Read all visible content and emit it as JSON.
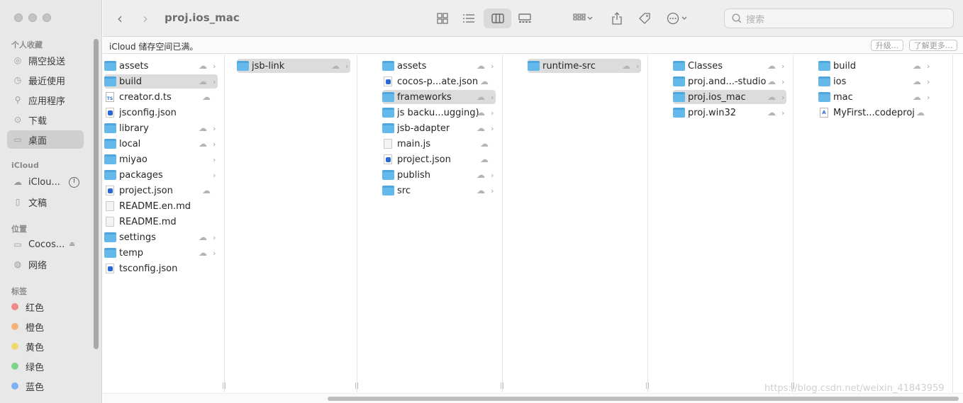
{
  "window": {
    "title": "proj.ios_mac"
  },
  "search": {
    "placeholder": "搜索"
  },
  "icloud_bar": {
    "message": "iCloud 储存空间已满。",
    "upgrade_label": "升级...",
    "learn_more_label": "了解更多..."
  },
  "sidebar": {
    "favorites_title": "个人收藏",
    "favorites": [
      {
        "label": "隔空投送",
        "icon": "airdrop-icon"
      },
      {
        "label": "最近使用",
        "icon": "clock-icon"
      },
      {
        "label": "应用程序",
        "icon": "apps-icon"
      },
      {
        "label": "下载",
        "icon": "download-icon"
      },
      {
        "label": "桌面",
        "icon": "desktop-icon",
        "selected": true
      }
    ],
    "icloud_title": "iCloud",
    "icloud": [
      {
        "label": "iClou...",
        "icon": "cloud-icon"
      },
      {
        "label": "文稿",
        "icon": "document-icon"
      }
    ],
    "locations_title": "位置",
    "locations": [
      {
        "label": "Cocos...",
        "icon": "drive-icon"
      },
      {
        "label": "网络",
        "icon": "network-icon"
      }
    ],
    "tags_title": "标签",
    "tags": [
      {
        "label": "红色",
        "color": "#f08a86"
      },
      {
        "label": "橙色",
        "color": "#f2b27a"
      },
      {
        "label": "黄色",
        "color": "#f0d86e"
      },
      {
        "label": "绿色",
        "color": "#7dd28c"
      },
      {
        "label": "蓝色",
        "color": "#7fb1f0"
      }
    ]
  },
  "columns": [
    {
      "items": [
        {
          "name": "assets",
          "type": "folder",
          "cloud": true,
          "chevron": true
        },
        {
          "name": "build",
          "type": "folder",
          "cloud": true,
          "chevron": true,
          "selected": true
        },
        {
          "name": "creator.d.ts",
          "type": "ts",
          "cloud": true
        },
        {
          "name": "jsconfig.json",
          "type": "json"
        },
        {
          "name": "library",
          "type": "folder",
          "cloud": true,
          "chevron": true
        },
        {
          "name": "local",
          "type": "folder",
          "cloud": true,
          "chevron": true
        },
        {
          "name": "miyao",
          "type": "folder",
          "chevron": true
        },
        {
          "name": "packages",
          "type": "folder",
          "chevron": true
        },
        {
          "name": "project.json",
          "type": "json",
          "cloud": true
        },
        {
          "name": "README.en.md",
          "type": "doc"
        },
        {
          "name": "README.md",
          "type": "doc"
        },
        {
          "name": "settings",
          "type": "folder",
          "cloud": true,
          "chevron": true
        },
        {
          "name": "temp",
          "type": "folder",
          "cloud": true,
          "chevron": true
        },
        {
          "name": "tsconfig.json",
          "type": "json"
        }
      ]
    },
    {
      "items": [
        {
          "name": "jsb-link",
          "type": "folder",
          "cloud": true,
          "chevron": true,
          "selected": true
        }
      ]
    },
    {
      "items": [
        {
          "name": "assets",
          "type": "folder",
          "cloud": true,
          "chevron": true
        },
        {
          "name": "cocos-p...ate.json",
          "type": "json",
          "cloud": true
        },
        {
          "name": "frameworks",
          "type": "folder",
          "cloud": true,
          "chevron": true,
          "selected": true
        },
        {
          "name": "js backu...ugging)",
          "type": "folder",
          "cloud": true,
          "chevron": true
        },
        {
          "name": "jsb-adapter",
          "type": "folder",
          "cloud": true,
          "chevron": true
        },
        {
          "name": "main.js",
          "type": "doc",
          "cloud": true
        },
        {
          "name": "project.json",
          "type": "json",
          "cloud": true
        },
        {
          "name": "publish",
          "type": "folder",
          "cloud": true,
          "chevron": true
        },
        {
          "name": "src",
          "type": "folder",
          "cloud": true,
          "chevron": true
        }
      ]
    },
    {
      "items": [
        {
          "name": "runtime-src",
          "type": "folder",
          "cloud": true,
          "chevron": true,
          "selected": true
        }
      ]
    },
    {
      "items": [
        {
          "name": "Classes",
          "type": "folder",
          "cloud": true,
          "chevron": true
        },
        {
          "name": "proj.and...-studio",
          "type": "folder",
          "cloud": true,
          "chevron": true
        },
        {
          "name": "proj.ios_mac",
          "type": "folder",
          "cloud": true,
          "chevron": true,
          "selected": true
        },
        {
          "name": "proj.win32",
          "type": "folder",
          "cloud": true,
          "chevron": true
        }
      ]
    },
    {
      "items": [
        {
          "name": "build",
          "type": "folder",
          "cloud": true,
          "chevron": true
        },
        {
          "name": "ios",
          "type": "folder",
          "cloud": true,
          "chevron": true
        },
        {
          "name": "mac",
          "type": "folder",
          "cloud": true,
          "chevron": true
        },
        {
          "name": "MyFirst...codeproj",
          "type": "xcodeproj",
          "cloud": true
        }
      ]
    }
  ],
  "watermark": "https://blog.csdn.net/weixin_41843959",
  "icons": {
    "cloud": "☁",
    "chevron": "›",
    "back": "‹",
    "forward": "›",
    "handle": "||"
  }
}
